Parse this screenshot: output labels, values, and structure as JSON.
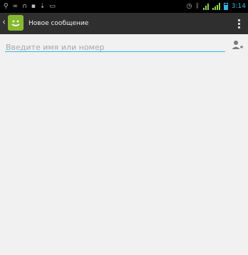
{
  "status_bar": {
    "left_icons": [
      "usb-icon",
      "voicemail-icon",
      "headset-icon",
      "sd-card-icon",
      "download-icon",
      "screenshot-icon"
    ],
    "right_icons": [
      "alarm-icon",
      "bluetooth-icon",
      "wifi-icon",
      "signal-icon",
      "battery-icon"
    ],
    "time": "3:14",
    "accent": "#33b5e5"
  },
  "action_bar": {
    "title": "Новое сообщение",
    "app_icon": "messaging-smiley-icon",
    "brand_color": "#86b930"
  },
  "compose": {
    "recipient_placeholder": "Введите имя или номер",
    "recipient_value": ""
  }
}
